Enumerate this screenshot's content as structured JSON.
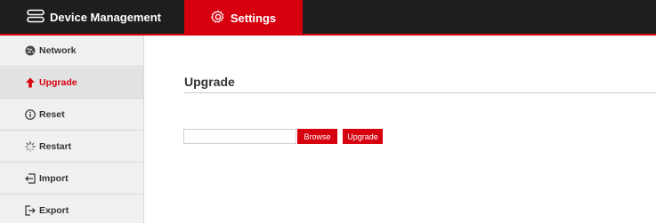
{
  "topbar": {
    "tabs": [
      {
        "label": "Device Management",
        "icon": "server-icon",
        "active": false
      },
      {
        "label": "Settings",
        "icon": "gear-icon",
        "active": true
      }
    ]
  },
  "sidebar": {
    "items": [
      {
        "label": "Network",
        "icon": "globe-icon",
        "active": false
      },
      {
        "label": "Upgrade",
        "icon": "arrow-up-icon",
        "active": true
      },
      {
        "label": "Reset",
        "icon": "info-circle-icon",
        "active": false
      },
      {
        "label": "Restart",
        "icon": "spinner-icon",
        "active": false
      },
      {
        "label": "Import",
        "icon": "import-icon",
        "active": false
      },
      {
        "label": "Export",
        "icon": "export-icon",
        "active": false
      }
    ]
  },
  "main": {
    "title": "Upgrade",
    "file_input": {
      "value": "",
      "placeholder": ""
    },
    "browse_label": "Browse",
    "upgrade_label": "Upgrade"
  },
  "colors": {
    "accent": "#d7000f",
    "topbar_bg": "#1e1e1e",
    "sidebar_bg": "#f0f0f0",
    "sidebar_active_bg": "#e2e2e2"
  }
}
